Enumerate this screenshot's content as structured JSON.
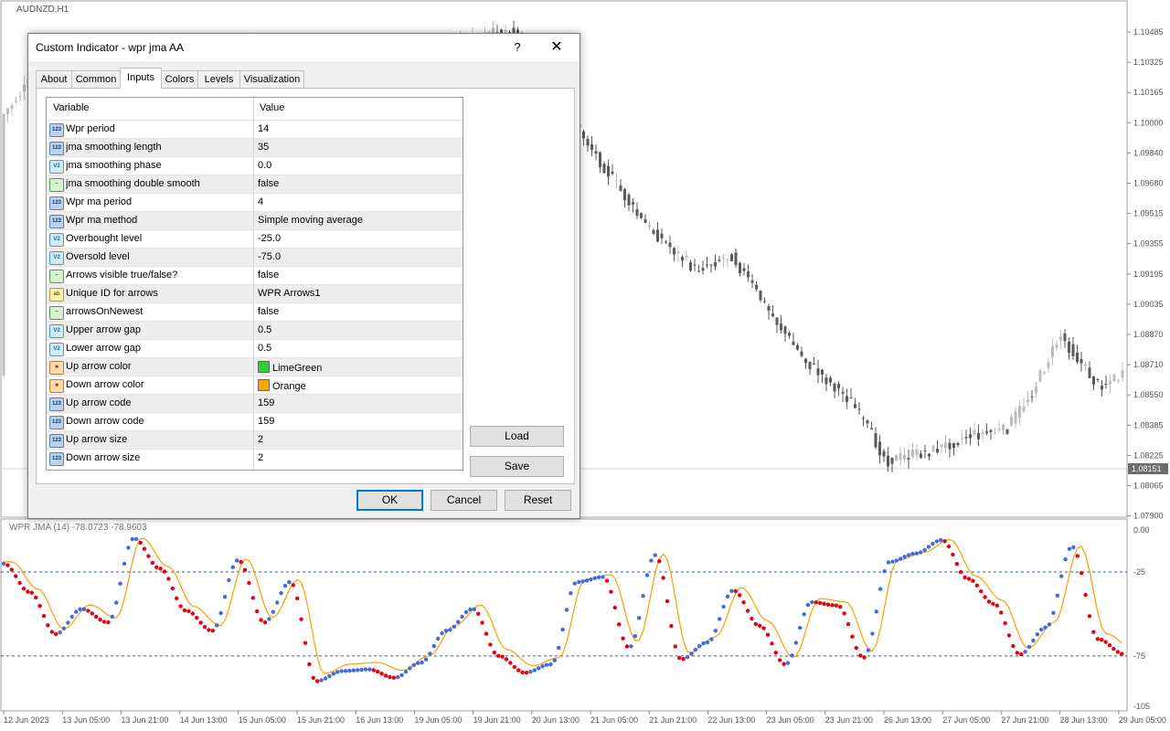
{
  "chart": {
    "symbol_label": "AUDNZD,H1",
    "current_price": "1.08151",
    "price_ticks": [
      "1.10485",
      "1.10325",
      "1.10165",
      "1.10000",
      "1.09840",
      "1.09680",
      "1.09515",
      "1.09355",
      "1.09195",
      "1.09035",
      "1.08870",
      "1.08710",
      "1.08550",
      "1.08385",
      "1.08225",
      "1.08065",
      "1.07900"
    ],
    "indicator_label": "WPR JMA (14) -78.0723 -78.9603",
    "indicator_ticks": [
      "0.00",
      "-25",
      "-75",
      "-105"
    ],
    "time_ticks": [
      "12 Jun 2023",
      "13 Jun 05:00",
      "13 Jun 21:00",
      "14 Jun 13:00",
      "15 Jun 05:00",
      "15 Jun 21:00",
      "16 Jun 13:00",
      "19 Jun 05:00",
      "19 Jun 21:00",
      "20 Jun 13:00",
      "21 Jun 05:00",
      "21 Jun 21:00",
      "22 Jun 13:00",
      "23 Jun 05:00",
      "23 Jun 21:00",
      "26 Jun 13:00",
      "27 Jun 05:00",
      "27 Jun 21:00",
      "28 Jun 13:00",
      "29 Jun 05:00"
    ],
    "colors": {
      "up_candle": "#bdbdbd",
      "down_candle": "#5a5a5a",
      "up_dot": "#4169e1",
      "down_dot": "#e8000b",
      "jma_line": "#ff9f00",
      "level_line": "#1f5fbf"
    }
  },
  "chart_data": {
    "type": "line",
    "title": "WPR JMA (14) -78.0723 -78.9603",
    "ylim": [
      -105,
      0
    ],
    "levels": [
      -25,
      -75
    ],
    "x": [
      "12 Jun 2023",
      "13 Jun 05:00",
      "13 Jun 21:00",
      "14 Jun 13:00",
      "15 Jun 05:00",
      "15 Jun 21:00",
      "16 Jun 13:00",
      "19 Jun 05:00",
      "19 Jun 21:00",
      "20 Jun 13:00",
      "21 Jun 05:00",
      "21 Jun 21:00",
      "22 Jun 13:00",
      "23 Jun 05:00",
      "23 Jun 21:00",
      "26 Jun 13:00",
      "27 Jun 05:00",
      "27 Jun 21:00",
      "28 Jun 13:00",
      "29 Jun 05:00"
    ],
    "series": [
      {
        "values": [
          -20,
          -37,
          -62,
          -47,
          -55,
          -5,
          -23,
          -48,
          -60,
          -18,
          -55,
          -31,
          -90,
          -84,
          -83,
          -88,
          -79,
          -60,
          -47,
          -75,
          -85,
          -80,
          -31,
          -28,
          -70,
          -15,
          -77,
          -67,
          -36,
          -57,
          -80,
          -43,
          -45,
          -76,
          -19,
          -14,
          -6,
          -29,
          -44,
          -74,
          -58,
          -10,
          -65,
          -74
        ]
      }
    ]
  },
  "dialog": {
    "title": "Custom Indicator - wpr  jma AA",
    "help": "?",
    "close": "✕",
    "tabs": [
      "About",
      "Common",
      "Inputs",
      "Colors",
      "Levels",
      "Visualization"
    ],
    "grid_header": {
      "variable": "Variable",
      "value": "Value"
    },
    "rows": [
      {
        "icon": "int",
        "icon_text": "123",
        "name": "Wpr period",
        "value": "14"
      },
      {
        "icon": "int",
        "icon_text": "123",
        "name": "jma smoothing length",
        "value": "35"
      },
      {
        "icon": "dbl",
        "icon_text": "V2",
        "name": "jma smoothing phase",
        "value": "0.0"
      },
      {
        "icon": "bool",
        "icon_text": "~",
        "name": "jma smoothing double smooth",
        "value": "false"
      },
      {
        "icon": "int",
        "icon_text": "123",
        "name": "Wpr ma period",
        "value": "4"
      },
      {
        "icon": "enum",
        "icon_text": "123",
        "name": "Wpr ma method",
        "value": "Simple moving average"
      },
      {
        "icon": "dbl",
        "icon_text": "V2",
        "name": "Overbought level",
        "value": "-25.0"
      },
      {
        "icon": "dbl",
        "icon_text": "V2",
        "name": "Oversold level",
        "value": "-75.0"
      },
      {
        "icon": "bool",
        "icon_text": "~",
        "name": "Arrows visible true/false?",
        "value": "false"
      },
      {
        "icon": "str",
        "icon_text": "ab",
        "name": "Unique ID for arrows",
        "value": "WPR Arrows1"
      },
      {
        "icon": "bool",
        "icon_text": "~",
        "name": "arrowsOnNewest",
        "value": "false"
      },
      {
        "icon": "dbl",
        "icon_text": "V2",
        "name": "Upper arrow gap",
        "value": "0.5"
      },
      {
        "icon": "dbl",
        "icon_text": "V2",
        "name": "Lower arrow gap",
        "value": "0.5"
      },
      {
        "icon": "clr",
        "icon_text": "■",
        "name": "Up arrow color",
        "value": "LimeGreen",
        "swatch": "#32cd32"
      },
      {
        "icon": "clr",
        "icon_text": "■",
        "name": "Down arrow color",
        "value": "Orange",
        "swatch": "#ffa500"
      },
      {
        "icon": "int",
        "icon_text": "123",
        "name": "Up arrow code",
        "value": "159"
      },
      {
        "icon": "int",
        "icon_text": "123",
        "name": "Down arrow code",
        "value": "159"
      },
      {
        "icon": "int",
        "icon_text": "123",
        "name": "Up arrow size",
        "value": "2"
      },
      {
        "icon": "int",
        "icon_text": "123",
        "name": "Down arrow size",
        "value": "2"
      }
    ],
    "buttons": {
      "load": "Load",
      "save": "Save",
      "ok": "OK",
      "cancel": "Cancel",
      "reset": "Reset"
    }
  }
}
